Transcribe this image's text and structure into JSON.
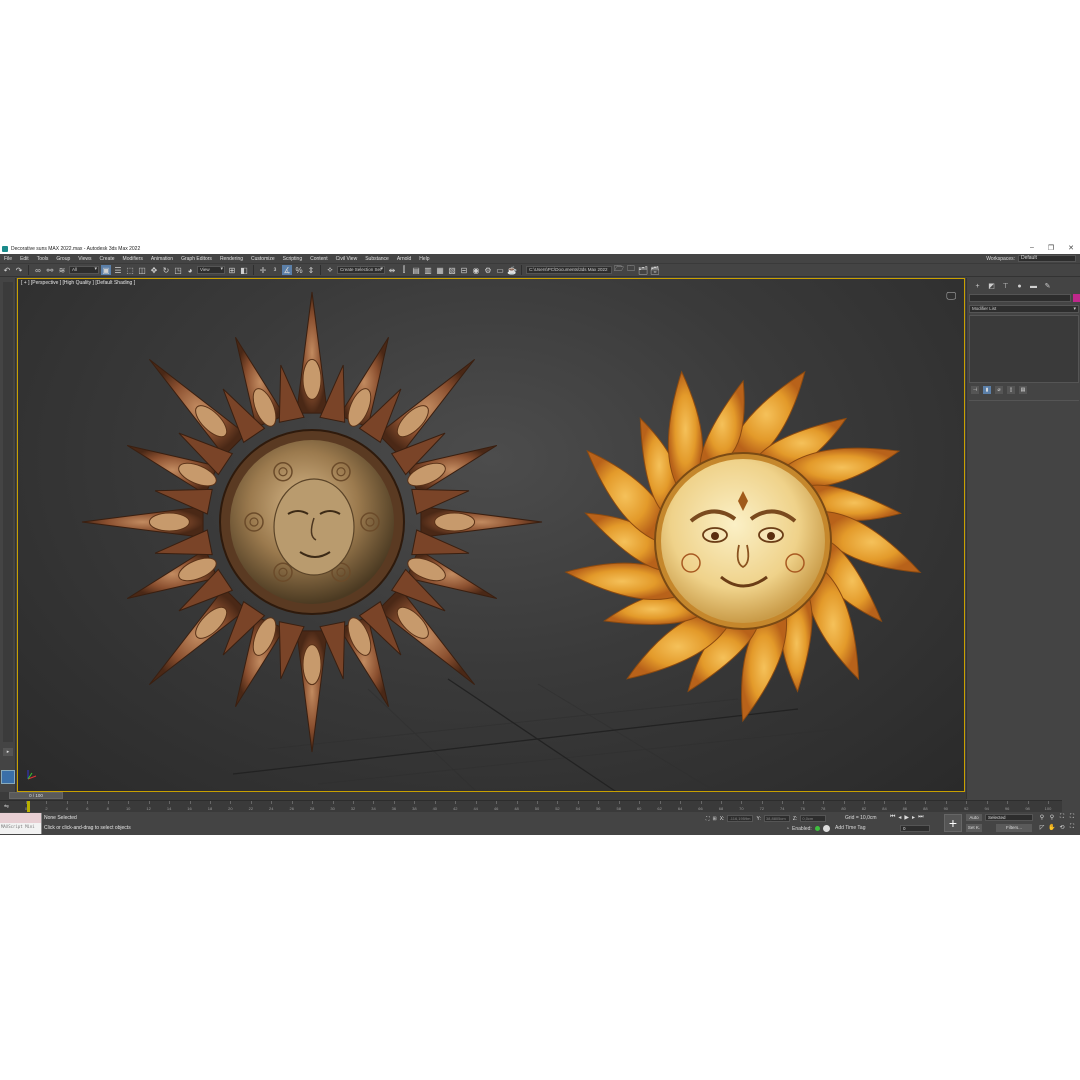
{
  "window": {
    "title": "Decorative suns MAX 2022.max - Autodesk 3ds Max 2022",
    "minimize": "–",
    "restore": "❐",
    "close": "✕"
  },
  "menu": {
    "items": [
      "File",
      "Edit",
      "Tools",
      "Group",
      "Views",
      "Create",
      "Modifiers",
      "Animation",
      "Graph Editors",
      "Rendering",
      "Customize",
      "Scripting",
      "Content",
      "Civil View",
      "Substance",
      "Arnold",
      "Help"
    ],
    "workspace_label": "Workspaces:",
    "workspace_value": "Default"
  },
  "toolbar": {
    "filter_value": "All",
    "view_value": "View",
    "selection_set": "Create Selection Set",
    "project_path": "C:\\Users\\PC\\Documents\\3ds Max 2022"
  },
  "viewport": {
    "label": "[ + ] [Perspective ] [High Quality ] [Default Shading ]"
  },
  "command_panel": {
    "modifier_list": "Modifier List"
  },
  "timeline": {
    "slider_label": "0 / 100",
    "ticks": [
      0,
      2,
      4,
      6,
      8,
      10,
      12,
      14,
      16,
      18,
      20,
      22,
      24,
      26,
      28,
      30,
      32,
      34,
      36,
      38,
      40,
      42,
      44,
      46,
      48,
      50,
      52,
      54,
      56,
      58,
      60,
      62,
      64,
      66,
      68,
      70,
      72,
      74,
      76,
      78,
      80,
      82,
      84,
      86,
      88,
      90,
      92,
      94,
      96,
      98,
      100
    ]
  },
  "status": {
    "maxscript_label": "MAXScript Mini",
    "selection": "None Selected",
    "prompt": "Click or click-and-drag to select objects",
    "x_label": "X:",
    "x_value": "-116,1959m",
    "y_label": "Y:",
    "y_value": "38,8805cm",
    "z_label": "Z:",
    "z_value": "0,0cm",
    "grid": "Grid = 10,0cm",
    "enabled_label": "Enabled:",
    "add_time_tag": "Add Time Tag",
    "frame_value": "0",
    "auto_key": "Auto",
    "set_key": "Set K.",
    "key_mode": "Selected",
    "filters": "Filters..."
  }
}
